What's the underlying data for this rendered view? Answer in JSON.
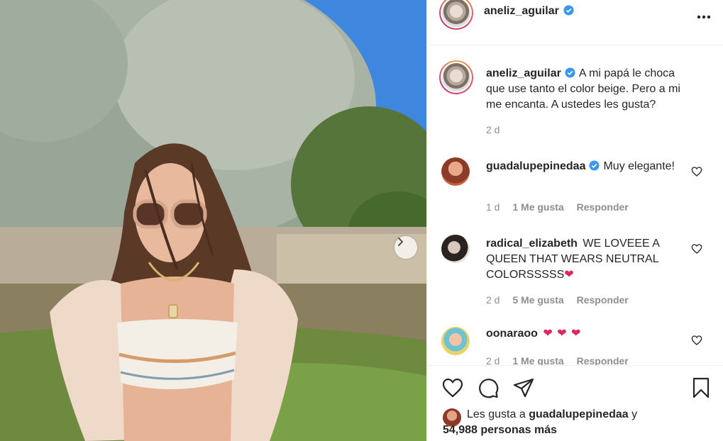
{
  "post": {
    "author": "aneliz_aguilar",
    "caption": "A mi papá le choca que use tanto el color beige. Pero a mi me encanta. A ustedes les gusta?",
    "caption_time": "2 d",
    "more_label": "•••"
  },
  "comments": [
    {
      "user": "guadalupepinedaa",
      "verified": true,
      "text": "Muy elegante!",
      "time": "1 d",
      "likes": "1 Me gusta",
      "reply": "Responder"
    },
    {
      "user": "radical_elizabeth",
      "verified": false,
      "text": "WE LOVEEE A QUEEN THAT WEARS NEUTRAL COLORSSSSS",
      "emoji": "❤",
      "time": "2 d",
      "likes": "5 Me gusta",
      "reply": "Responder"
    },
    {
      "user": "oonaraoo",
      "verified": false,
      "text": "",
      "emoji": "❤ ❤ ❤",
      "time": "2 d",
      "likes": "1 Me gusta",
      "reply": "Responder"
    }
  ],
  "likes_line": {
    "prefix": "Les gusta a",
    "user": "guadalupepinedaa",
    "suffix": "y",
    "count": "54,988 personas más"
  },
  "icons": {
    "like": "heart-icon",
    "comment": "comment-icon",
    "share": "paper-plane-icon",
    "save": "bookmark-icon",
    "next": "chevron-right-icon",
    "verified": "verified-badge-icon",
    "more": "more-options-icon"
  },
  "colors": {
    "verified": "#3897f0",
    "text": "#262626",
    "meta": "#8e8e8e",
    "heart_emoji": "#e0245e"
  }
}
